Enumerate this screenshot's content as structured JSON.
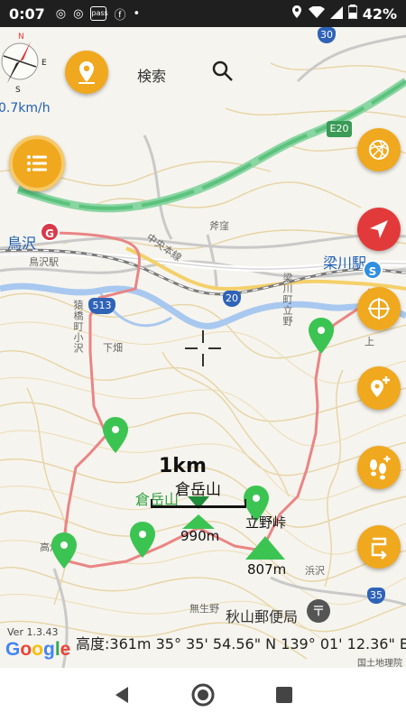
{
  "status_bar": {
    "time": "0:07",
    "battery": "42%",
    "icons": [
      "instagram-icon",
      "instagram-icon",
      "pass-icon",
      "facebook-icon",
      "dot-icon",
      "location-icon",
      "wifi-icon",
      "signal-icon",
      "battery-icon"
    ],
    "pass_text": "pass"
  },
  "toolbar": {
    "search_label": "検索",
    "speed": "0.7km/h",
    "compass": {
      "north": "N",
      "south": "S",
      "east": "E"
    }
  },
  "map": {
    "labels": {
      "torisawa": "鳥沢",
      "torisawa_station": "鳥沢駅",
      "chuo_line": "中央本線",
      "route_513": "513",
      "route_20": "20",
      "route_30": "30",
      "route_35": "35",
      "e20": "E20",
      "benkei": "斧窪",
      "shimohata": "下畑",
      "kamitoshi": "猿橋町小沢",
      "yanagawa": "梁川町立野",
      "yanagawa_station": "梁川駅",
      "ue": "上",
      "kuratake_green": "倉岳山",
      "takahata": "高畑",
      "hamazawa": "浜沢",
      "muuno": "無生野",
      "akiyama_post": "秋山郵便局"
    },
    "peaks": {
      "kuratake_name": "倉岳山",
      "kuratake_elev": "990m",
      "tateno_pass": "立野峠",
      "tateno_elev": "807m"
    },
    "scale": "1km",
    "accent_route": "#e98585",
    "accent_marker": "#3cc453",
    "accent_button": "#f0a81e"
  },
  "footer": {
    "version": "Ver 1.3.43",
    "google": [
      "G",
      "o",
      "o",
      "g",
      "l",
      "e"
    ],
    "coords": "高度:361m  35° 35' 54.56\" N 139° 01' 12.36\" E",
    "gsi": "国土地理院"
  },
  "nav": {
    "back": "back-icon",
    "home": "home-icon",
    "recent": "recent-icon"
  }
}
